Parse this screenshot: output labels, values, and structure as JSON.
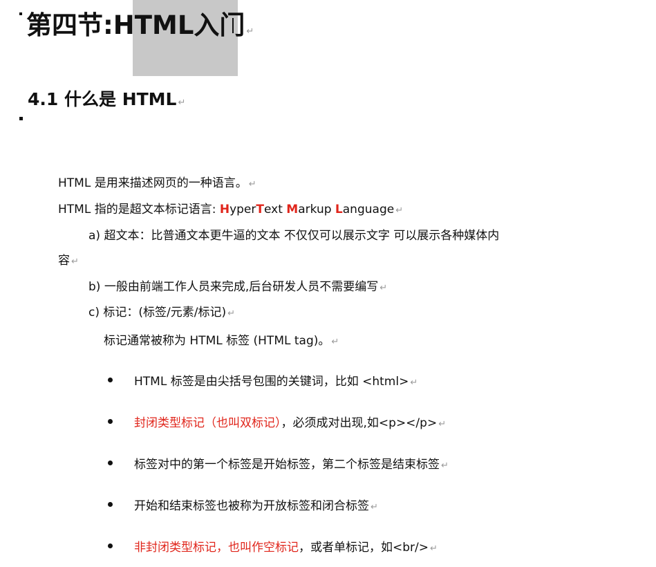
{
  "heading1": {
    "text": "第四节:HTML入门"
  },
  "heading2": {
    "text": "4.1 什么是 HTML"
  },
  "paragraphs": {
    "p1": "HTML  是用来描述网页的一种语言。",
    "p2_prefix": "HTML  指的是超文本标记语言: ",
    "p2_h": "H",
    "p2_yper": "yper",
    "p2_t": "T",
    "p2_ext": "ext ",
    "p2_m": "M",
    "p2_arkup": "arkup ",
    "p2_l": "L",
    "p2_anguage": "anguage",
    "item_a_line1": "a) 超文本：比普通文本更牛逼的文本  不仅仅可以展示文字  可以展示各种媒体内",
    "item_a_line2": "容",
    "item_b": "b) 一般由前端工作人员来完成,后台研发人员不需要编写",
    "item_c": "c) 标记：(标签/元素/标记)",
    "item_c_desc": "标记通常被称为  HTML  标签  (HTML  tag)。"
  },
  "bullets": {
    "b1": "HTML  标签是由尖括号包围的关键词，比如  <html>",
    "b2_red": "封闭类型标记（也叫双标记）",
    "b2_rest": "，必须成对出现,如<p></p>",
    "b3": "标签对中的第一个标签是开始标签，第二个标签是结束标签",
    "b4": "开始和结束标签也被称为开放标签和闭合标签",
    "b5_red": "非封闭类型标记，也叫作空标记",
    "b5_rest": "，或者单标记，如<br/>"
  },
  "paragraph_mark": "↵",
  "colors": {
    "accent_red": "#e0251b",
    "selection": "#c8c8c8"
  }
}
